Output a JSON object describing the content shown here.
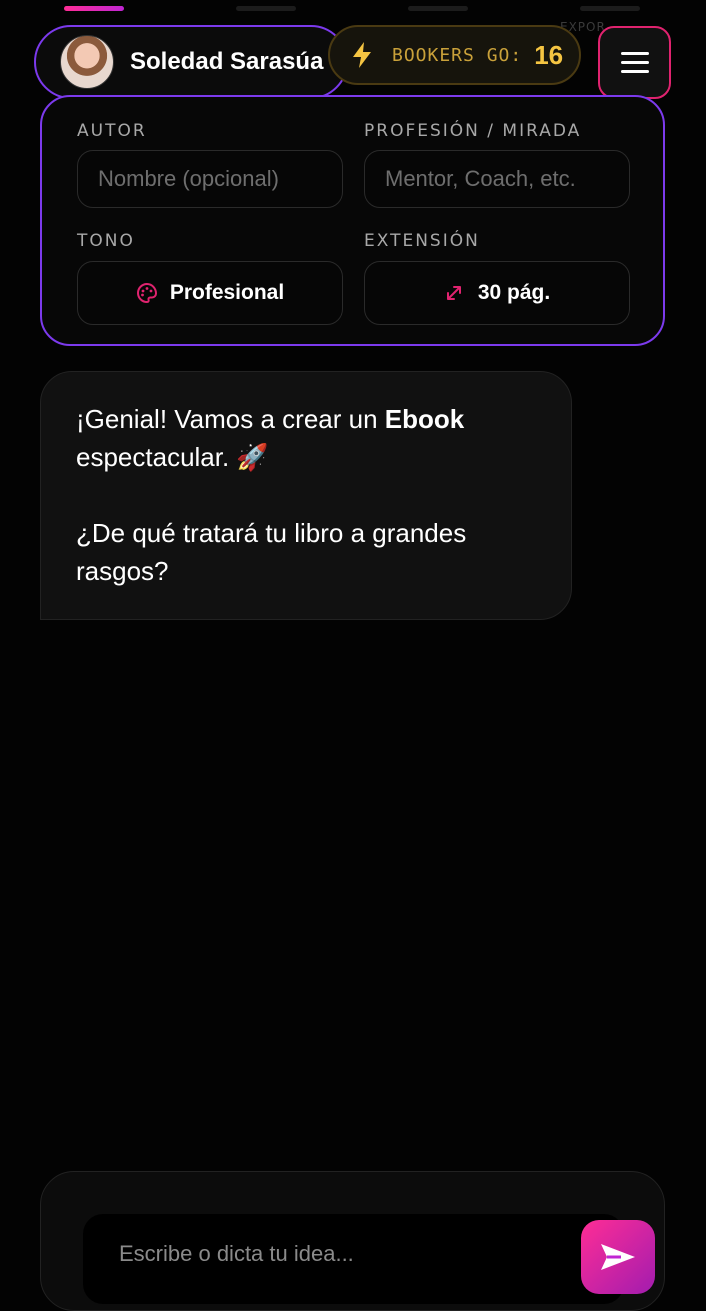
{
  "steps": [
    {
      "label": "",
      "active": true
    },
    {
      "label": "",
      "active": false
    },
    {
      "label": "",
      "active": false
    },
    {
      "label": "EXPOR",
      "active": false
    }
  ],
  "user": {
    "name": "Soledad Sarasúa",
    "avatar_icon": "user-avatar"
  },
  "bookers": {
    "label": "BOOKERS GO:",
    "count": "16",
    "icon": "bolt-icon"
  },
  "menu": {
    "icon": "hamburger-menu-icon"
  },
  "settings": {
    "author": {
      "label": "AUTOR",
      "value": "",
      "placeholder": "Nombre (opcional)"
    },
    "profession": {
      "label": "PROFESIÓN / MIRADA",
      "value": "",
      "placeholder": "Mentor, Coach, etc."
    },
    "tone": {
      "label": "TONO",
      "value": "Profesional",
      "icon": "palette-icon"
    },
    "extension": {
      "label": "EXTENSIÓN",
      "value": "30 pág.",
      "icon": "expand-arrows-icon"
    }
  },
  "message": {
    "line1_prefix": "¡Genial! Vamos a crear un ",
    "line1_bold": "Ebook",
    "line2": "espectacular. 🚀",
    "question": "¿De qué tratará tu libro a grandes rasgos?"
  },
  "composer": {
    "placeholder": "Escribe o dicta tu idea...",
    "value": "",
    "send_icon": "send-icon"
  },
  "colors": {
    "accent": "#e0236f",
    "purple": "#7c3aed",
    "gold": "#f5c542",
    "background": "#030303"
  }
}
